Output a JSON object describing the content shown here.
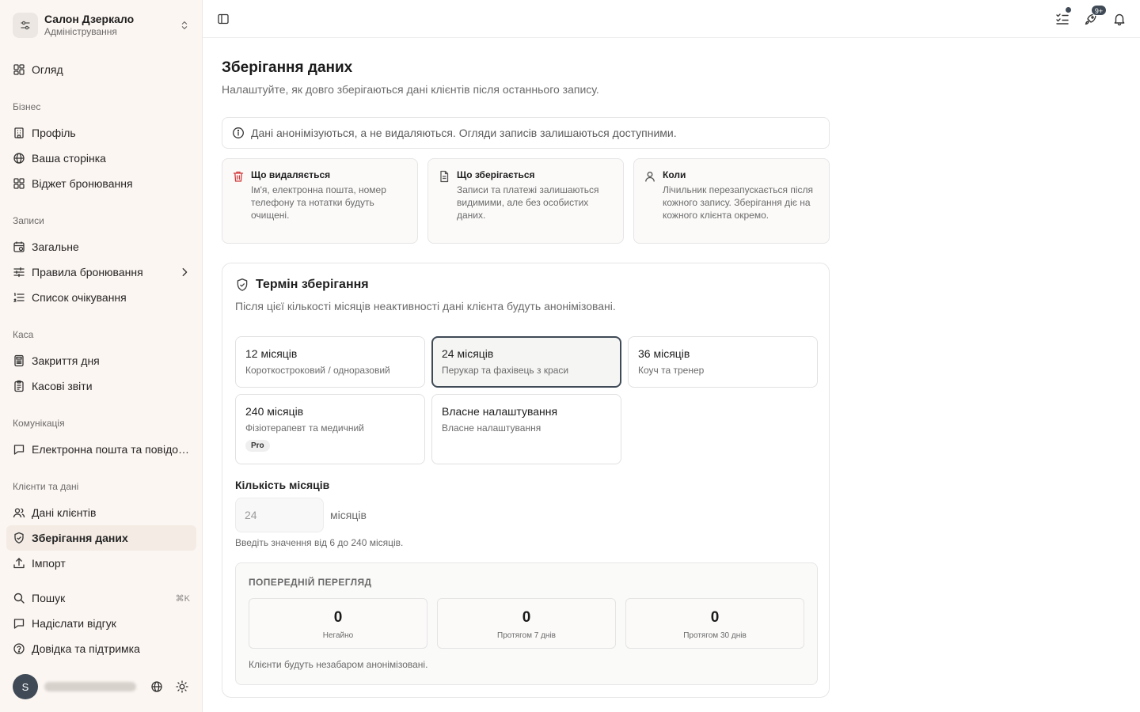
{
  "brand": {
    "name": "Салон Дзеркало",
    "subtitle": "Адміністрування"
  },
  "sidebar": {
    "overview": "Огляд",
    "sections": {
      "business": "Бізнес",
      "bookings": "Записи",
      "cash": "Каса",
      "communication": "Комунікація",
      "clients": "Клієнти та дані"
    },
    "items": {
      "profile": "Профіль",
      "your_page": "Ваша сторінка",
      "booking_widget": "Віджет бронювання",
      "general": "Загальне",
      "booking_rules": "Правила бронювання",
      "waitlist": "Список очікування",
      "day_close": "Закриття дня",
      "cash_reports": "Касові звіти",
      "email_messages": "Електронна пошта та повідомлення",
      "client_data": "Дані клієнтів",
      "data_retention": "Зберігання даних",
      "import": "Імпорт",
      "search": "Пошук",
      "search_shortcut": "⌘K",
      "feedback": "Надіслати відгук",
      "help": "Довідка та підтримка"
    },
    "user": {
      "initial": "S"
    }
  },
  "topbar": {
    "notification_count": "9+"
  },
  "page": {
    "title": "Зберігання даних",
    "subtitle": "Налаштуйте, як довго зберігаються дані клієнтів після останнього запису.",
    "info": "Дані анонімізуються, а не видаляються. Огляди записів залишаються доступними."
  },
  "cards": [
    {
      "icon": "trash-icon",
      "title": "Що видаляється",
      "desc": "Ім'я, електронна пошта, номер телефону та нотатки будуть очищені."
    },
    {
      "icon": "document-icon",
      "title": "Що зберігається",
      "desc": "Записи та платежі залишаються видимими, але без особистих даних."
    },
    {
      "icon": "user-icon",
      "title": "Коли",
      "desc": "Лічильник перезапускається після кожного запису. Зберігання діє на кожного клієнта окремо."
    }
  ],
  "retention": {
    "title": "Термін зберігання",
    "subtitle": "Після цієї кількості місяців неактивності дані клієнта будуть анонімізовані.",
    "options": [
      {
        "title": "12 місяців",
        "desc": "Короткостроковий / одноразовий"
      },
      {
        "title": "24 місяців",
        "desc": "Перукар та фахівець з краси"
      },
      {
        "title": "36 місяців",
        "desc": "Коуч та тренер"
      },
      {
        "title": "240 місяців",
        "desc": "Фізіотерапевт та медичний",
        "badge": "Pro"
      },
      {
        "title": "Власне налаштування",
        "desc": "Власне налаштування"
      }
    ],
    "selected": "24 місяців",
    "months_label": "Кількість місяців",
    "months_value": "24",
    "months_unit": "місяців",
    "hint": "Введіть значення від 6 до 240 місяців."
  },
  "preview": {
    "title": "ПОПЕРЕДНІЙ ПЕРЕГЛЯД",
    "stats": [
      {
        "value": "0",
        "label": "Негайно"
      },
      {
        "value": "0",
        "label": "Протягом 7 днів"
      },
      {
        "value": "0",
        "label": "Протягом 30 днів"
      }
    ],
    "note": "Клієнти будуть незабаром анонімізовані."
  },
  "colors": {
    "sidebar_bg": "#fcf6f2",
    "accent": "#3f4a56",
    "danger": "#d13c3c"
  }
}
